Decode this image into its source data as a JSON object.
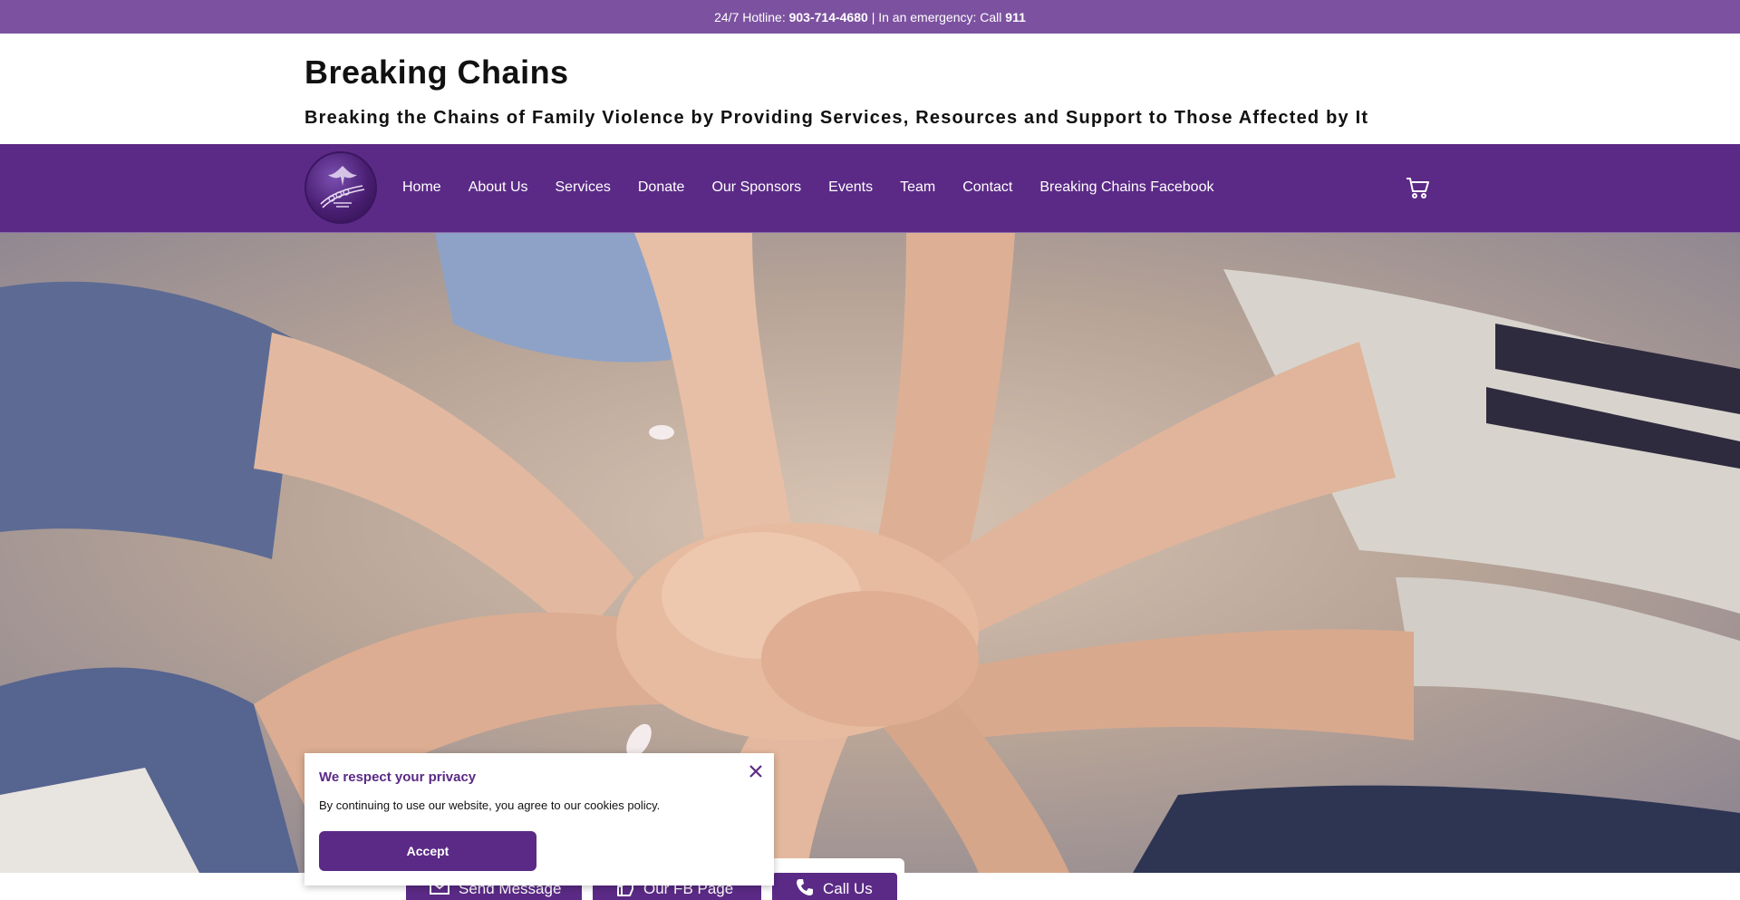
{
  "topbar": {
    "hotline_label": "24/7 Hotline:",
    "hotline_number": "903-714-4680",
    "separator": "|",
    "emergency_label": "In an emergency: Call",
    "emergency_number": "911"
  },
  "header": {
    "site_title": "Breaking Chains",
    "tagline": "Breaking the Chains of Family Violence by Providing Services, Resources and Support to Those Affected by It"
  },
  "nav": {
    "logo_icon": "breaking-chains-logo",
    "links": [
      "Home",
      "About Us",
      "Services",
      "Donate",
      "Our Sponsors",
      "Events",
      "Team",
      "Contact",
      "Breaking Chains Facebook"
    ],
    "cart_icon": "cart-icon"
  },
  "cookie": {
    "title": "We respect your privacy",
    "text": "By continuing to use our website, you agree to our cookies policy.",
    "accept_label": "Accept",
    "close_icon": "close-icon"
  },
  "actions": {
    "send_message": "Send Message",
    "fb_page": "Our FB Page",
    "call_us": "Call Us"
  },
  "colors": {
    "topbar": "#7c52a0",
    "primary": "#5b2a86",
    "white": "#ffffff"
  }
}
